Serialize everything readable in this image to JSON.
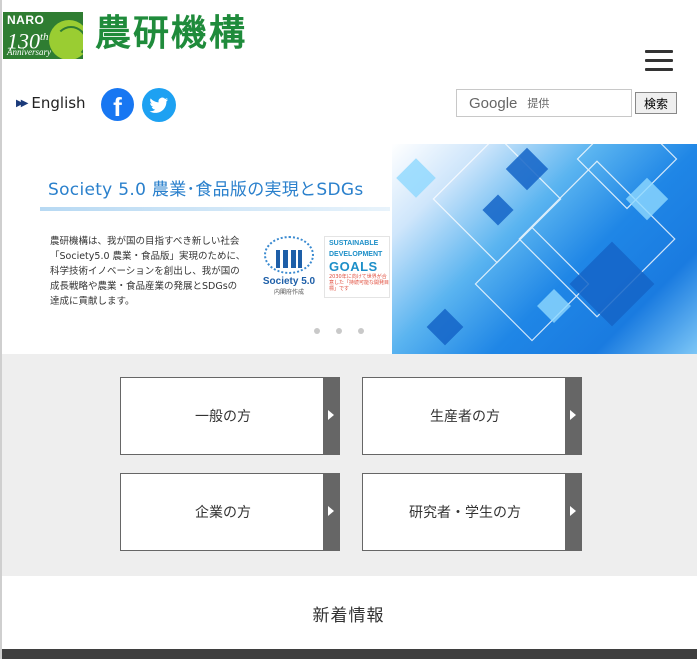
{
  "header": {
    "badge_org": "NARO",
    "badge_number": "130",
    "badge_suffix": "th",
    "badge_anniversary": "Anniversary",
    "logo_title": "農研機構",
    "english_label": "English"
  },
  "search": {
    "google_label": "Google",
    "provided_label": "提供",
    "button_label": "検索"
  },
  "banner": {
    "title": "Society 5.0 農業･食品版の実現とSDGs",
    "body_lines": [
      "農研機構は、我が国の目指すべき新しい社会",
      "「Society5.0 農業・食品版」実現のために、",
      "科学技術イノベーションを創出し、我が国の",
      "成長戦略や農業・食品産業の発展とSDGsの",
      "達成に貢献します。"
    ],
    "society_label": "Society 5.0",
    "society_sub": "内閣府作成",
    "sdg_line1": "SUSTAINABLE",
    "sdg_line2": "DEVELOPMENT",
    "sdg_goals": "GOALS",
    "sdg_note": "2030年に向けて世界が合意した「持続可能な開発目標」です"
  },
  "categories": [
    {
      "label": "一般の方"
    },
    {
      "label": "生産者の方"
    },
    {
      "label": "企業の方"
    },
    {
      "label": "研究者・学生の方"
    }
  ],
  "news": {
    "title": "新着情報"
  },
  "colors": {
    "logo_green": "#1f8b3b",
    "facebook": "#1877f2",
    "twitter": "#1da1f2",
    "category_bar": "#666666"
  }
}
